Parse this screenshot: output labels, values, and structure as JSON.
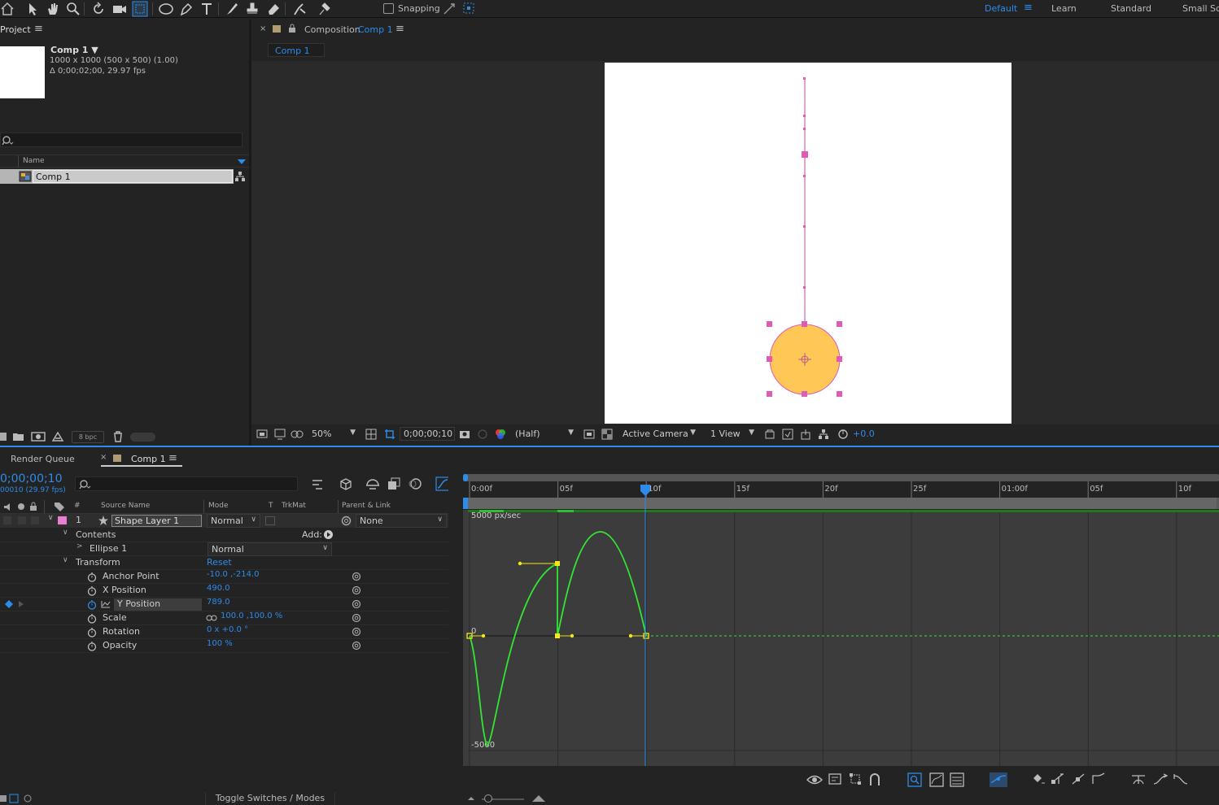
{
  "toolbar": {
    "snapping_label": "Snapping",
    "workspaces": [
      "Default",
      "Learn",
      "Standard",
      "Small Sc"
    ],
    "active_workspace": "Default",
    "menu_icon": "≡"
  },
  "project_panel": {
    "tab_label": "Project",
    "comp_name": "Comp 1 ▼",
    "comp_info_1": "1000 x 1000  (500 x 500) (1.00)",
    "comp_info_2": "Δ 0;00;02;00, 29.97 fps",
    "column_name": "Name",
    "item_name": "Comp 1",
    "bpc": "8 bpc"
  },
  "comp_panel": {
    "tab_prefix": "Composition",
    "tab_name": "Comp 1",
    "flow_tab": "Comp 1",
    "zoom": "50%",
    "timecode": "0;00;00;10",
    "resolution": "(Half)",
    "camera": "Active Camera",
    "views": "1 View",
    "exposure": "+0.0"
  },
  "timeline": {
    "render_queue_tab": "Render Queue",
    "comp_tab": "Comp 1",
    "current_time": "0;00;00;10",
    "frame_info": "00010 (29.97 fps)",
    "col_source": "Source Name",
    "col_mode": "Mode",
    "col_t": "T",
    "col_trkmat": "TrkMat",
    "col_parent": "Parent & Link",
    "col_hash": "#",
    "layer_num": "1",
    "layer_name": "Shape Layer 1",
    "layer_mode": "Normal",
    "layer_parent": "None",
    "contents": "Contents",
    "add_label": "Add:",
    "ellipse": "Ellipse 1",
    "ellipse_mode": "Normal",
    "transform": "Transform",
    "reset": "Reset",
    "props": [
      {
        "name": "Anchor Point",
        "value": "-10.0 ,-214.0"
      },
      {
        "name": "X Position",
        "value": "490.0"
      },
      {
        "name": "Y Position",
        "value": "789.0"
      },
      {
        "name": "Scale",
        "value": "100.0 ,100.0 %"
      },
      {
        "name": "Rotation",
        "value": "0 x +0.0 °"
      },
      {
        "name": "Opacity",
        "value": "100 %"
      }
    ],
    "ruler_labels": [
      "0:00f",
      "05f",
      "10f",
      "15f",
      "20f",
      "25f",
      "01:00f",
      "05f",
      "10f"
    ],
    "graph_top_label": "5000 px/sec",
    "graph_zero": "0",
    "graph_bottom": "-5000",
    "toggle_label": "Toggle Switches / Modes"
  },
  "colors": {
    "accent": "#2d8ceb",
    "curve": "#33e533",
    "keyframe": "#f4e71a",
    "layer_label": "#e87ed2",
    "ellipse_fill": "#fec756",
    "motion_path": "#e060c0"
  }
}
